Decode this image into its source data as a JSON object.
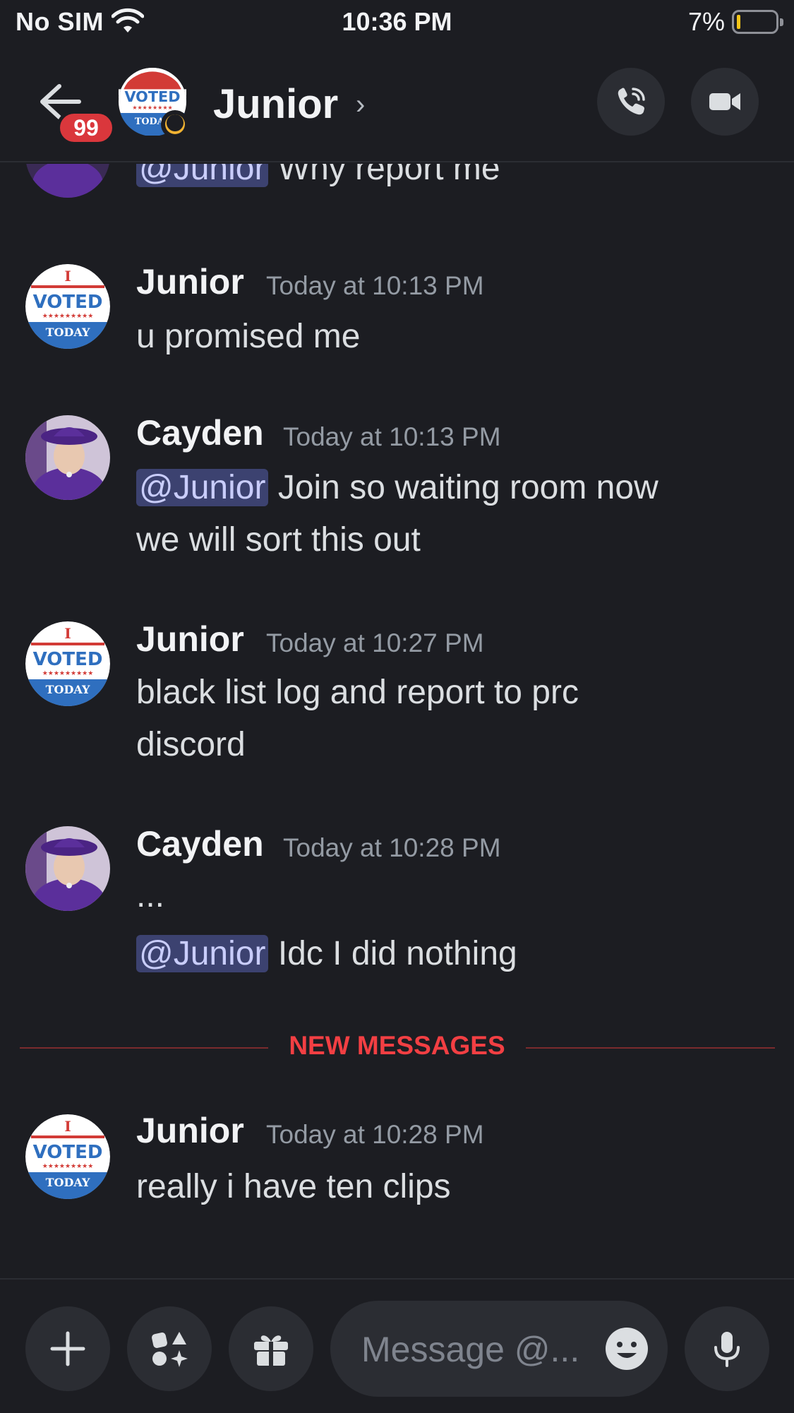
{
  "status_bar": {
    "carrier": "No SIM",
    "time": "10:36 PM",
    "battery": "7%"
  },
  "header": {
    "title": "Junior",
    "chevron": "›",
    "unread_count": "99",
    "status": "dnd-moon-icon"
  },
  "messages": [
    {
      "type": "continuation",
      "mention": "@Junior",
      "text": "Why report me"
    },
    {
      "author": "Junior",
      "avatar": "i-voted-today",
      "time": "Today at 10:13 PM",
      "lines": [
        "u promised me"
      ]
    },
    {
      "author": "Cayden",
      "avatar": "purple-hat",
      "time": "Today at 10:13 PM",
      "mention": "@Junior",
      "text": "Join so waiting room now",
      "text2": "we will sort this out"
    },
    {
      "author": "Junior",
      "avatar": "i-voted-today",
      "time": "Today at 10:27 PM",
      "lines": [
        "black list log and report to prc",
        "discord"
      ]
    },
    {
      "author": "Cayden",
      "avatar": "purple-hat",
      "time": "Today at 10:28 PM",
      "lines": [
        "..."
      ],
      "mention": "@Junior",
      "text": "Idc I did nothing"
    },
    {
      "author": "Junior",
      "avatar": "i-voted-today",
      "time": "Today at 10:28 PM",
      "lines": [
        "really i have ten clips"
      ]
    }
  ],
  "divider": {
    "label": "NEW MESSAGES"
  },
  "composer": {
    "placeholder": "Message @..."
  },
  "colors": {
    "background": "#1c1d22",
    "mention_bg": "#3c4270",
    "new_messages": "#f23f43"
  }
}
